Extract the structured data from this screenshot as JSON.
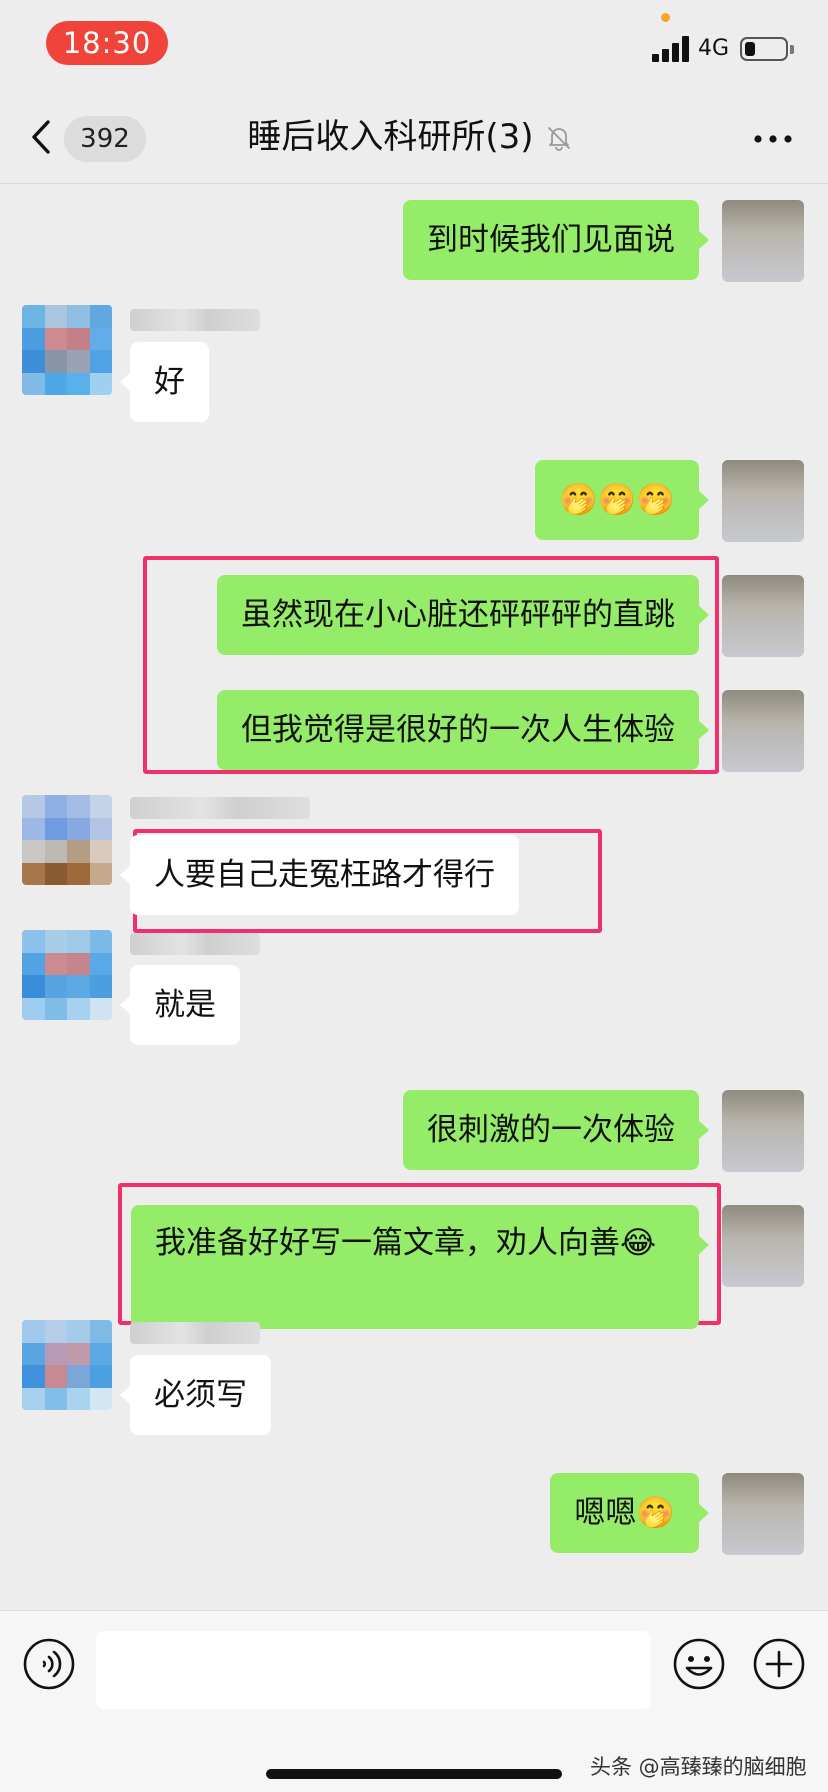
{
  "status_bar": {
    "time": "18:30",
    "network": "4G",
    "battery_level": 0.25
  },
  "nav": {
    "unread_count": "392",
    "title": "睡后收入科研所(3)",
    "icons": {
      "back": "back-chevron-icon",
      "mute": "bell-muted-icon",
      "more": "more-dots-icon"
    }
  },
  "messages": [
    {
      "side": "self",
      "text": "到时候我们见面说"
    },
    {
      "side": "other",
      "text": "好"
    },
    {
      "side": "self",
      "text": "🤭🤭🤭"
    },
    {
      "side": "self",
      "text": "虽然现在小心脏还砰砰砰的直跳"
    },
    {
      "side": "self",
      "text": "但我觉得是很好的一次人生体验"
    },
    {
      "side": "other",
      "text": "人要自己走冤枉路才得行"
    },
    {
      "side": "other",
      "text": "就是"
    },
    {
      "side": "self",
      "text": "很刺激的一次体验"
    },
    {
      "side": "self",
      "text": "我准备好好写一篇文章，劝人向善😂"
    },
    {
      "side": "other",
      "text": "必须写"
    },
    {
      "side": "self",
      "text": "嗯嗯🤭"
    }
  ],
  "input_bar": {
    "icons": {
      "voice": "voice-icon",
      "emoji": "emoji-icon",
      "plus": "plus-icon"
    },
    "input_value": ""
  },
  "watermark": "头条 @高臻臻的脑细胞",
  "colors": {
    "self_bubble": "#95ec69",
    "other_bubble": "#ffffff",
    "highlight": "#f0306b",
    "time_pill": "#f0433a",
    "background": "#ededed"
  }
}
